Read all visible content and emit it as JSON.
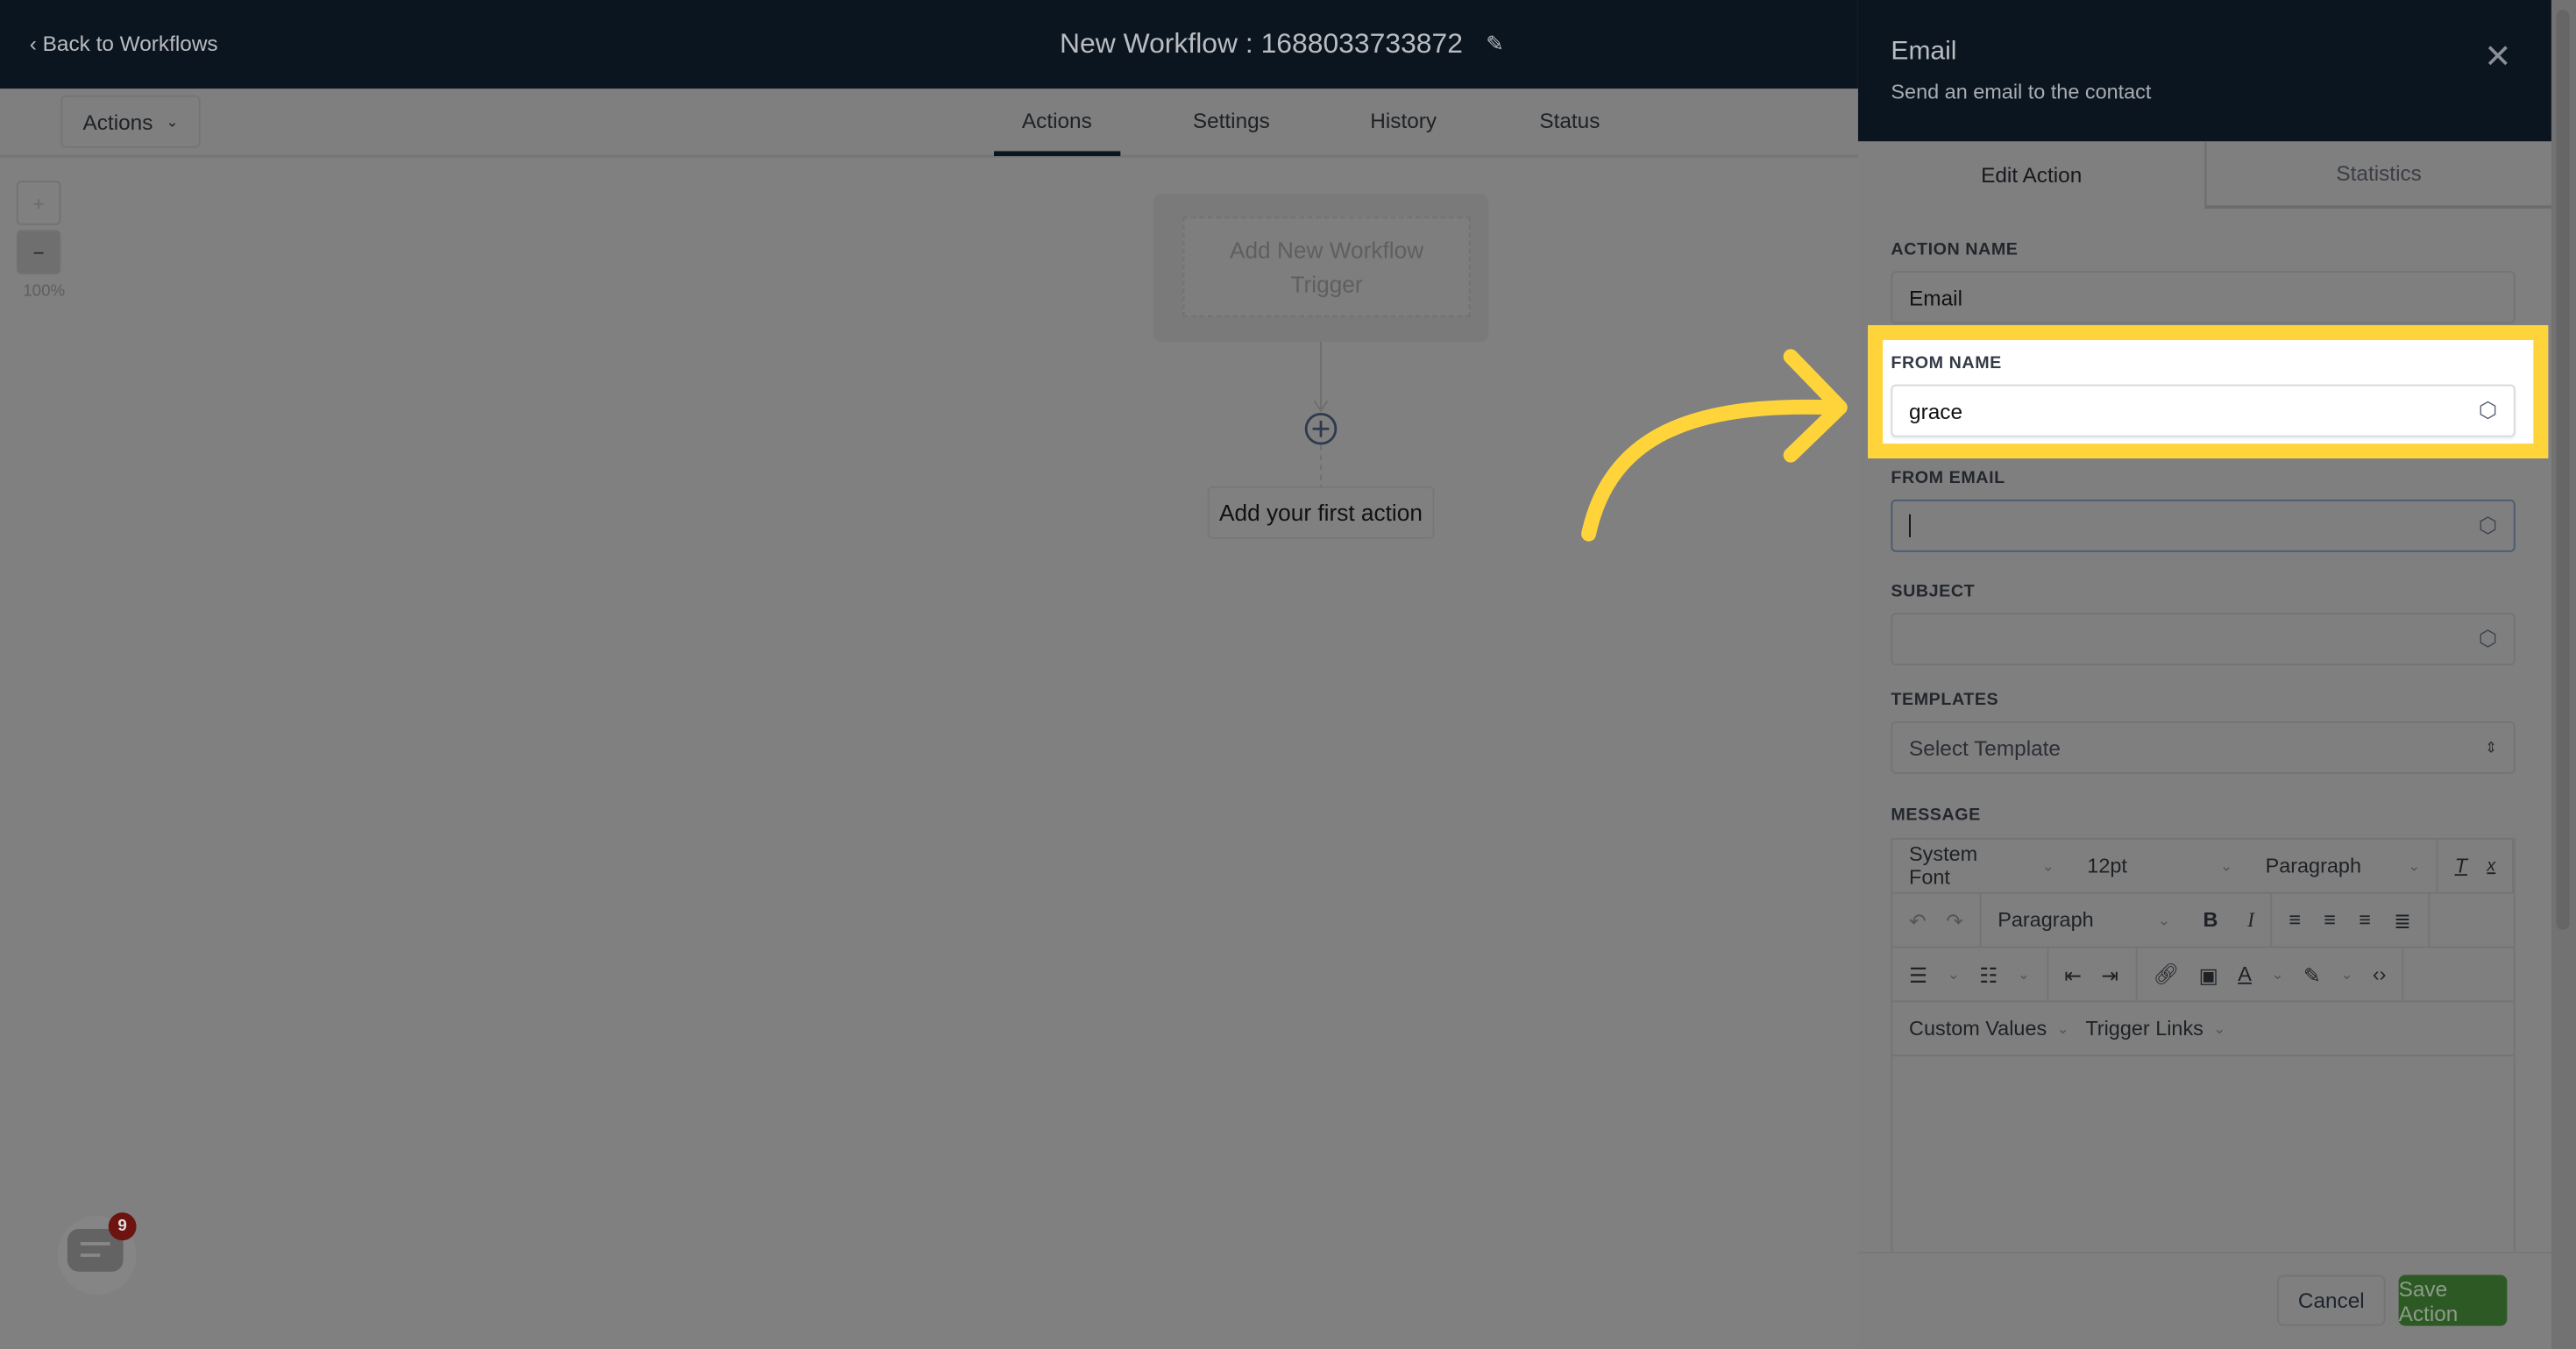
{
  "header": {
    "back_label": "Back to Workflows",
    "title": "New Workflow : 1688033733872"
  },
  "toolbar": {
    "actions_label": "Actions",
    "tabs": [
      {
        "label": "Actions",
        "active": true
      },
      {
        "label": "Settings"
      },
      {
        "label": "History"
      },
      {
        "label": "Status"
      }
    ]
  },
  "canvas": {
    "zoom_in": "+",
    "zoom_out": "−",
    "zoom_level": "100%",
    "trigger_label": "Add New Workflow Trigger",
    "first_action_label": "Add your first action"
  },
  "panel": {
    "title": "Email",
    "subtitle": "Send an email to the contact",
    "tabs": [
      {
        "label": "Edit Action",
        "active": true
      },
      {
        "label": "Statistics"
      }
    ],
    "fields": {
      "action_name": {
        "label": "ACTION NAME",
        "value": "Email"
      },
      "from_name": {
        "label": "FROM NAME",
        "value": "grace"
      },
      "from_email": {
        "label": "FROM EMAIL",
        "value": ""
      },
      "subject": {
        "label": "SUBJECT",
        "value": ""
      },
      "templates": {
        "label": "TEMPLATES",
        "placeholder": "Select Template"
      }
    },
    "message": {
      "label": "MESSAGE",
      "font": "System Font",
      "size": "12pt",
      "block": "Paragraph",
      "block2": "Paragraph",
      "custom_values": "Custom Values",
      "trigger_links": "Trigger Links"
    },
    "footer": {
      "cancel": "Cancel",
      "save": "Save Action"
    }
  },
  "chat_widget": {
    "badge": "9"
  },
  "colors": {
    "header": "#0b1520",
    "highlight": "#ffd43b",
    "save": "#2d5a24",
    "overlay": "#808080"
  }
}
